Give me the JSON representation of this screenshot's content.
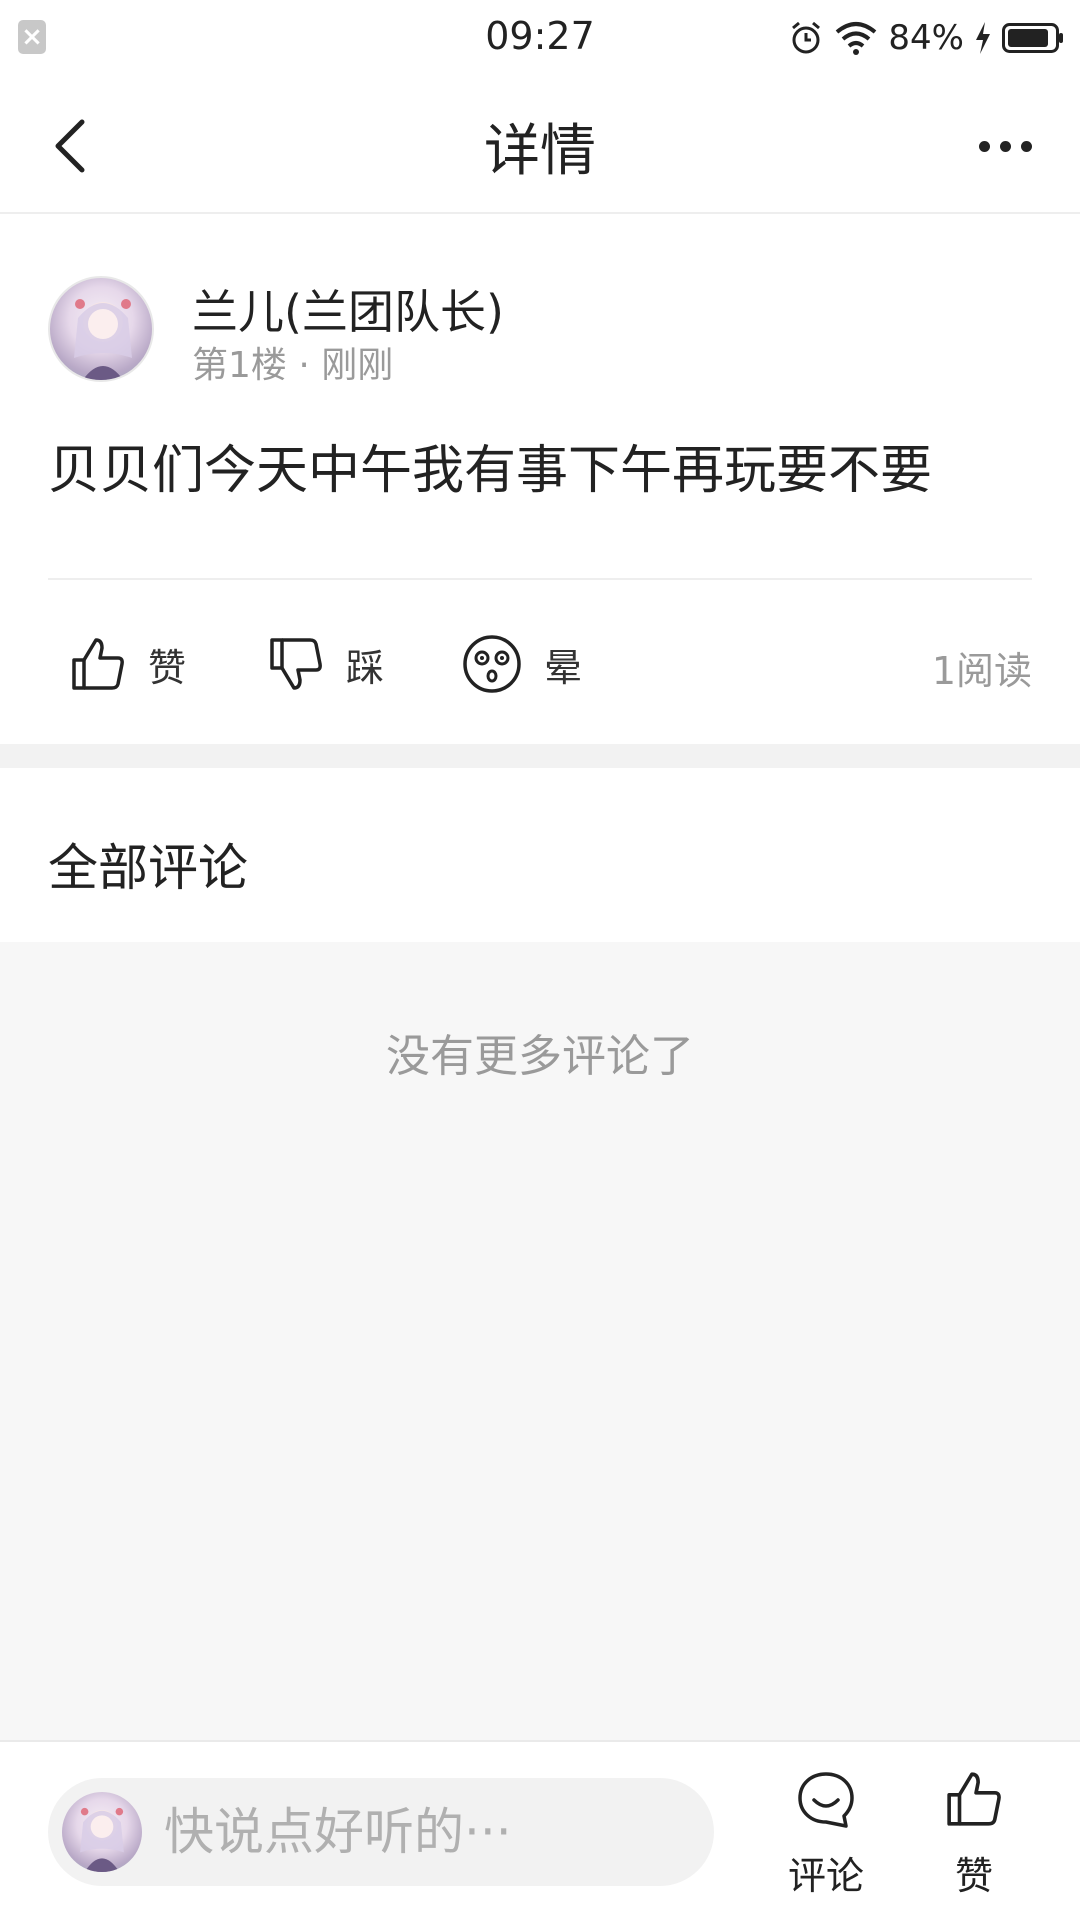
{
  "status_bar": {
    "time": "09:27",
    "battery": "84%"
  },
  "header": {
    "title": "详情"
  },
  "post": {
    "author": "兰儿(兰团队长)",
    "meta": "第1楼 · 刚刚",
    "content": "贝贝们今天中午我有事下午再玩要不要",
    "actions": {
      "like": "赞",
      "dislike": "踩",
      "dizzy": "晕"
    },
    "reads": "1阅读"
  },
  "comments": {
    "title": "全部评论",
    "empty_text": "没有更多评论了"
  },
  "bottom_bar": {
    "placeholder": "快说点好听的···",
    "comment_label": "评论",
    "like_label": "赞"
  },
  "colors": {
    "text_primary": "#222222",
    "text_secondary": "#9a9a9a",
    "background_gray": "#f7f7f7"
  },
  "icons": [
    "close-icon",
    "alarm-icon",
    "wifi-icon",
    "charging-icon",
    "battery-icon",
    "back-icon",
    "more-icon",
    "thumbs-up-icon",
    "thumbs-down-icon",
    "dizzy-face-icon",
    "comment-icon"
  ]
}
